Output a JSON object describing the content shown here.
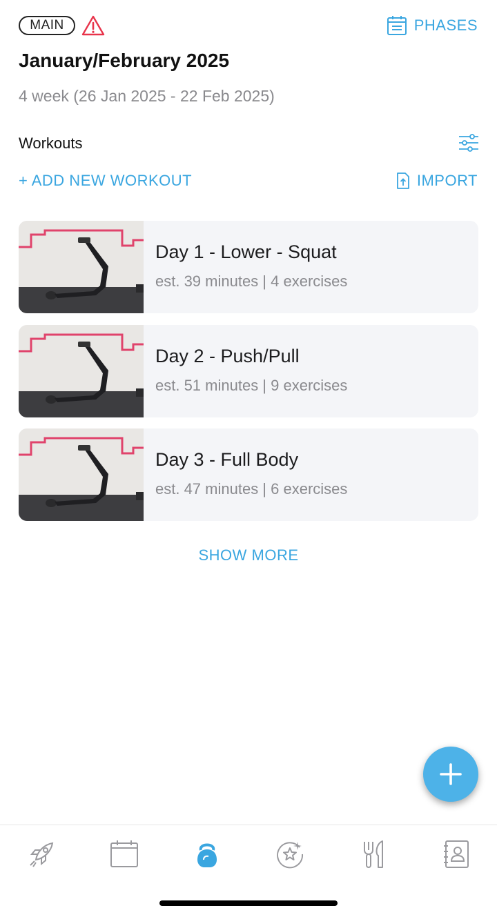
{
  "header": {
    "badge": "MAIN",
    "phases_label": "PHASES",
    "title": "January/February 2025",
    "subtitle": "4 week (26 Jan 2025 - 22 Feb 2025)"
  },
  "workouts_section": {
    "label": "Workouts",
    "add_label": "+ ADD NEW WORKOUT",
    "import_label": "IMPORT"
  },
  "workouts": [
    {
      "title": "Day 1 - Lower - Squat",
      "meta": "est. 39 minutes | 4 exercises"
    },
    {
      "title": "Day 2 - Push/Pull",
      "meta": "est. 51 minutes | 9 exercises"
    },
    {
      "title": "Day 3 - Full Body",
      "meta": "est. 47 minutes | 6 exercises"
    }
  ],
  "show_more": "SHOW MORE",
  "tabs": [
    {
      "icon": "rocket-icon",
      "active": false
    },
    {
      "icon": "calendar-icon",
      "active": false
    },
    {
      "icon": "kettlebell-icon",
      "active": true
    },
    {
      "icon": "star-badge-icon",
      "active": false
    },
    {
      "icon": "fork-knife-icon",
      "active": false
    },
    {
      "icon": "contact-book-icon",
      "active": false
    }
  ],
  "colors": {
    "accent": "#3aa6e0",
    "warning": "#e8334a",
    "muted_text": "#8a8a8e",
    "card_bg": "#f4f5f8"
  }
}
